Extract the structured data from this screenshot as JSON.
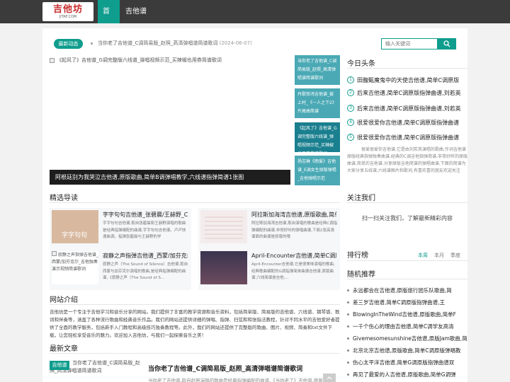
{
  "site": {
    "logo_text": "吉他坊",
    "logo_sub": "JITAF.COM",
    "nav": [
      "首页",
      "吉他谱"
    ],
    "accent": "#0f9d8d"
  },
  "news": {
    "badge": "最新动态",
    "text": "当你老了吉他谱_C调简易版_赵照_高清弹唱谱简谱歌词",
    "date": "(2024-06-07)"
  },
  "search": {
    "placeholder": "输入关键词",
    "icon": "search-icon"
  },
  "slider": {
    "img_alt": "《起风了》吉他谱_G调完整版六线谱_弹唱视频示范_买辣椒也用券简谱歌词",
    "caption": "阿根廷别为我哭泣吉他谱,原版歌曲,简单B调弹唱教学,六线谱指弹简谱1张图",
    "thumbs": [
      "当你老了吉他谱_C调简易版_赵照_高清弹唱谱简谱歌词",
      "丹歌惊鸿吉他谱_被上村_《一人之下2》片尾曲简谱",
      "《起风了》吉他谱_G调完整版六线谱_弹唱视频示范_买辣椒也用券简谱歌词",
      "扬志琳《雨爱》吉他谱_E调女生原版弹唱_吉他弹唱示范"
    ]
  },
  "headlines": {
    "title": "今日头条",
    "items": [
      "田馥甄魔鬼中的天使吉他谱,简单C调原版",
      "后来吉他谱,简单C调原版指弹曲谱,刘若英",
      "后来吉他谱,简单C调原版指弹曲谱,刘若英",
      "很爱很爱你吉他谱,简单C调原版指弹曲谱",
      "很爱很爱你吉他谱,简单C调原版指弹曲谱"
    ],
    "desc": "很爱很爱你吉他谱,它是由刘若英演唱的歌曲,作词吉他谱原版经典指弹独奏曲谱,经典的C调吉他指弹简谱,非常好听的原版曲谱,简单的吉他谱,分享原版吉他简谱的弹唱曲谱,下面的简谱为大家分享五线谱,六线谱图片和歌词,有喜欢喜的朋友欢迎关注"
  },
  "featured": {
    "title": "精选导读",
    "items": [
      {
        "title": "字字句句吉他谱_张碧晨/王赫野_C调简单版_吉他弹唱",
        "desc": "字字句句吉他谱,取自张碧晨和王赫野演唱的歌曲是经典指弹编配的曲谱,字字句句吉他谱。卢卢快速曲调。指弹张碧晨与王赫野的学",
        "img_text": "字字句句"
      },
      {
        "title": "阿拉斯加海湾吉他谱,原版歌曲,简单C调弹唱教学",
        "desc": "阿拉斯加海湾吉他谱,取自演唱的歌曲是经典C调指弹编配的曲谱,非常好听的弹唱曲谱,下面2张高清谱面的曲谱是原版的哦",
        "img_text": ""
      },
      {
        "title": "寂静之声指弹吉他谱_西蒙/加芬克尔_原版",
        "desc": "寂静之声（The Sound of Silence）吉他谱,取自西蒙与加芬克尔演唱的歌曲,是经典指弹编配的曲谱,《寂静之声（The Sound of S...",
        "img_text": "寂静之声指弹吉他谱_西蒙/加芬克尔_吉他独奏演示视频简谱歌词"
      },
      {
        "title": "April-Encounter吉他谱,简单C调原版",
        "desc": "April-Encounter吉他谱,它是很美味演唱的歌曲,经典歌曲编配的G调指弹简单曲谱吉他谱,原版曲谱,六线简谱是吉他,...",
        "img_text": ""
      }
    ]
  },
  "follow": {
    "title": "关注我们",
    "text": "扫一扫关注我们，了解最新精彩内容"
  },
  "ranking": {
    "title": "排行榜",
    "tabs": [
      "本周",
      "本月",
      "季度"
    ]
  },
  "random": {
    "title": "随机推荐",
    "items": [
      "永远都会在吉他谱,原版旅行团乐队歌曲,简",
      "差三岁吉他谱,简单C调原版指弹曲谱,王",
      "BlowingInTheWind吉他谱,原版歌曲,简单F",
      "一千个伤心的理由吉他谱,简单C调学友高清",
      "Givemesomesunshine吉他谱,原版Jam歌曲,简",
      "北京北京吉他谱,原版歌曲,简单C调原版弹唱教",
      "伤心太平洋吉他谱,简单G调原版指弹曲谱双",
      "再见了最爱的人吉他谱,原版歌曲,简单G调弹"
    ]
  },
  "about": {
    "title": "网站介绍",
    "text": "吉他坊是一个专注于吉他学习和音乐分享的网站。我们提供了丰富的教学资源和音乐资料，包括简单版、简易版的吉他谱、六线谱、钢琴谱、歌词和伴奏等，涵盖了各种流行歌曲和经典音乐作品。我们的网站还提供详细的弹唱、指弹、扫弦和和张指法教程，针对不同水平的吉他爱好者提供了全面的教学服务，包括新手入门教程和高级技巧独奏教程等。此外，我们的网站还提供了完整版的歌曲、图片、视频、简奏和txt文件下载，让您轻松享受音乐的魅力。欢迎加入吉他坊，与我们一起探索音乐之美！"
  },
  "latest": {
    "title": "最新文章",
    "tag": "吉他谱",
    "img_alt": "当你老了吉他谱_C调简易版_赵照_高清弹唱谱简谱歌词",
    "item_title": "当你老了吉他谱_C调简易版_赵照_高清弹唱谱简谱歌词",
    "item_desc": "当你老了吉他谱,取自赵照演唱的歌曲是经典指弹编配的曲谱,《当你老了》吉他谱,原版..."
  }
}
